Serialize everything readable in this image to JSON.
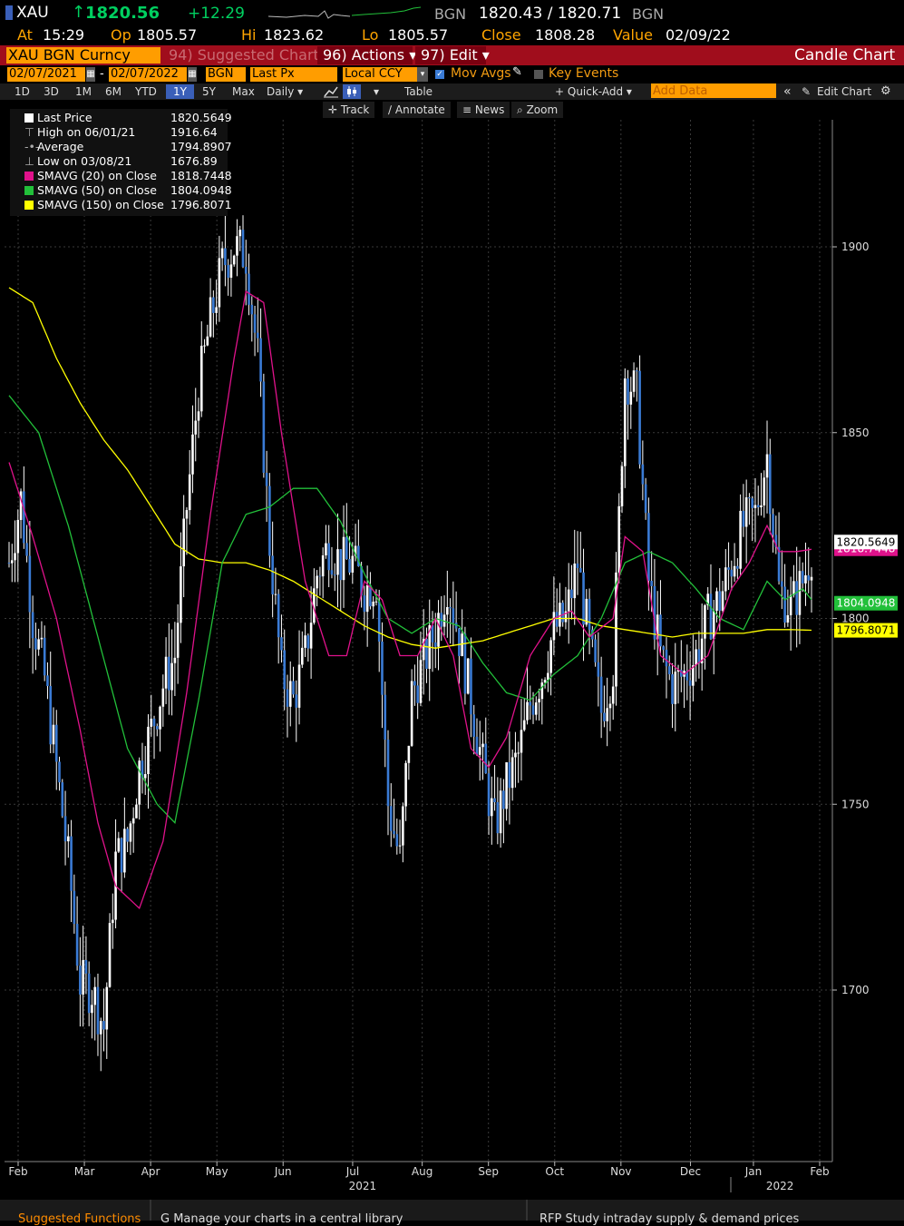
{
  "header": {
    "ticker": "XAU",
    "arrow": "↑",
    "last": "1820.56",
    "change": "+12.29",
    "source1": "BGN",
    "bidask": "1820.43 / 1820.71",
    "source2": "BGN",
    "at_label": "At",
    "at_value": "15:29",
    "op_label": "Op",
    "op_value": "1805.57",
    "hi_label": "Hi",
    "hi_value": "1823.62",
    "lo_label": "Lo",
    "lo_value": "1805.57",
    "close_label": "Close",
    "close_value": "1808.28",
    "value_label": "Value",
    "value_date": "02/09/22"
  },
  "titlebar": {
    "security": "XAU BGN Curncy",
    "suggested": "94) Suggested Charts",
    "actions": "96) Actions ▾",
    "edit": "97) Edit ▾",
    "chart_name": "Candle Chart"
  },
  "controls": {
    "start_date": "02/07/2021",
    "dash": "-",
    "end_date": "02/07/2022",
    "source": "BGN",
    "field": "Last Px",
    "currency": "Local CCY",
    "mov_avgs": "Mov Avgs",
    "key_events": "Key Events"
  },
  "periods": [
    "1D",
    "3D",
    "1M",
    "6M",
    "YTD",
    "1Y",
    "5Y",
    "Max"
  ],
  "selected_period": "1Y",
  "frequency": "Daily ▾",
  "table_label": "Table",
  "quick_add": "+ Quick-Add ▾",
  "add_data_placeholder": "Add Data",
  "edit_chart": "Edit Chart",
  "tools": [
    "Track",
    "Annotate",
    "News",
    "Zoom"
  ],
  "legend": [
    {
      "label": "Last Price",
      "value": "1820.5649",
      "color": "#ffffff"
    },
    {
      "label": "High on 06/01/21",
      "value": "1916.64",
      "color": "#aaaaaa"
    },
    {
      "label": "Average",
      "value": "1794.8907",
      "color": "#aaaaaa"
    },
    {
      "label": "Low on 03/08/21",
      "value": "1676.89",
      "color": "#aaaaaa"
    },
    {
      "label": "SMAVG (20)  on Close",
      "value": "1818.7448",
      "color": "#e0128b"
    },
    {
      "label": "SMAVG (50)  on Close",
      "value": "1804.0948",
      "color": "#22c03a"
    },
    {
      "label": "SMAVG (150)  on Close",
      "value": "1796.8071",
      "color": "#ffff00"
    }
  ],
  "bottom_bar": {
    "item1": "Suggested Functions",
    "item2": "G  Manage your charts in a central library",
    "item3": "RFP  Study intraday supply & demand prices"
  },
  "chart_data": {
    "type": "candlestick",
    "ylim": [
      1665,
      1935
    ],
    "y_ticks": [
      1700,
      1750,
      1800,
      1850,
      1900
    ],
    "x_ticks": [
      {
        "label": "Feb",
        "d": 0
      },
      {
        "label": "Mar",
        "d": 20
      },
      {
        "label": "Apr",
        "d": 40
      },
      {
        "label": "May",
        "d": 60
      },
      {
        "label": "Jun",
        "d": 80
      },
      {
        "label": "Jul",
        "d": 101
      },
      {
        "label": "Aug",
        "d": 122
      },
      {
        "label": "Sep",
        "d": 142
      },
      {
        "label": "Oct",
        "d": 162
      },
      {
        "label": "Nov",
        "d": 182
      },
      {
        "label": "Dec",
        "d": 203
      },
      {
        "label": "Jan",
        "d": 222
      },
      {
        "label": "Feb",
        "d": 242
      }
    ],
    "year_labels": [
      {
        "label": "2021",
        "d": 104
      },
      {
        "label": "2022",
        "d": 230
      }
    ],
    "last_price": 1820.5649,
    "sma20_last": 1818.7448,
    "sma50_last": 1804.0948,
    "sma150_last": 1796.8071,
    "close_keys": [
      [
        0,
        1815
      ],
      [
        4,
        1832
      ],
      [
        8,
        1800
      ],
      [
        12,
        1784
      ],
      [
        16,
        1760
      ],
      [
        20,
        1735
      ],
      [
        24,
        1702
      ],
      [
        28,
        1700
      ],
      [
        32,
        1690
      ],
      [
        36,
        1735
      ],
      [
        40,
        1740
      ],
      [
        44,
        1760
      ],
      [
        48,
        1770
      ],
      [
        52,
        1782
      ],
      [
        56,
        1790
      ],
      [
        60,
        1830
      ],
      [
        64,
        1862
      ],
      [
        68,
        1880
      ],
      [
        72,
        1895
      ],
      [
        76,
        1900
      ],
      [
        80,
        1898
      ],
      [
        84,
        1870
      ],
      [
        88,
        1820
      ],
      [
        92,
        1785
      ],
      [
        96,
        1778
      ],
      [
        100,
        1790
      ],
      [
        104,
        1812
      ],
      [
        108,
        1820
      ],
      [
        112,
        1815
      ],
      [
        116,
        1815
      ],
      [
        120,
        1808
      ],
      [
        124,
        1810
      ],
      [
        128,
        1750
      ],
      [
        132,
        1735
      ],
      [
        136,
        1780
      ],
      [
        140,
        1788
      ],
      [
        144,
        1797
      ],
      [
        148,
        1810
      ],
      [
        152,
        1795
      ],
      [
        156,
        1778
      ],
      [
        160,
        1760
      ],
      [
        164,
        1744
      ],
      [
        168,
        1755
      ],
      [
        172,
        1763
      ],
      [
        176,
        1777
      ],
      [
        180,
        1785
      ],
      [
        184,
        1797
      ],
      [
        188,
        1800
      ],
      [
        192,
        1815
      ],
      [
        196,
        1793
      ],
      [
        200,
        1775
      ],
      [
        204,
        1787
      ],
      [
        208,
        1866
      ],
      [
        212,
        1860
      ],
      [
        216,
        1810
      ],
      [
        220,
        1790
      ],
      [
        224,
        1782
      ],
      [
        228,
        1785
      ],
      [
        232,
        1790
      ],
      [
        236,
        1800
      ],
      [
        240,
        1805
      ],
      [
        244,
        1815
      ],
      [
        248,
        1825
      ],
      [
        252,
        1828
      ],
      [
        256,
        1844
      ],
      [
        260,
        1808
      ],
      [
        264,
        1803
      ],
      [
        268,
        1810
      ],
      [
        272,
        1820.56
      ]
    ],
    "sma20_keys": [
      [
        0,
        1842
      ],
      [
        8,
        1822
      ],
      [
        16,
        1800
      ],
      [
        24,
        1770
      ],
      [
        30,
        1745
      ],
      [
        36,
        1728
      ],
      [
        44,
        1722
      ],
      [
        52,
        1740
      ],
      [
        60,
        1780
      ],
      [
        68,
        1828
      ],
      [
        76,
        1870
      ],
      [
        80,
        1888
      ],
      [
        86,
        1885
      ],
      [
        92,
        1850
      ],
      [
        100,
        1810
      ],
      [
        108,
        1790
      ],
      [
        114,
        1790
      ],
      [
        120,
        1810
      ],
      [
        126,
        1805
      ],
      [
        132,
        1790
      ],
      [
        138,
        1790
      ],
      [
        144,
        1800
      ],
      [
        150,
        1790
      ],
      [
        156,
        1765
      ],
      [
        162,
        1760
      ],
      [
        168,
        1768
      ],
      [
        176,
        1790
      ],
      [
        184,
        1800
      ],
      [
        190,
        1802
      ],
      [
        196,
        1795
      ],
      [
        204,
        1800
      ],
      [
        208,
        1822
      ],
      [
        214,
        1818
      ],
      [
        220,
        1790
      ],
      [
        228,
        1785
      ],
      [
        236,
        1790
      ],
      [
        244,
        1808
      ],
      [
        250,
        1815
      ],
      [
        256,
        1825
      ],
      [
        260,
        1818
      ],
      [
        266,
        1818
      ],
      [
        272,
        1818.74
      ]
    ],
    "sma50_keys": [
      [
        0,
        1860
      ],
      [
        10,
        1850
      ],
      [
        20,
        1825
      ],
      [
        30,
        1795
      ],
      [
        40,
        1765
      ],
      [
        50,
        1750
      ],
      [
        56,
        1745
      ],
      [
        64,
        1778
      ],
      [
        72,
        1815
      ],
      [
        80,
        1828
      ],
      [
        88,
        1830
      ],
      [
        96,
        1835
      ],
      [
        104,
        1835
      ],
      [
        112,
        1826
      ],
      [
        120,
        1812
      ],
      [
        128,
        1800
      ],
      [
        136,
        1796
      ],
      [
        144,
        1800
      ],
      [
        152,
        1798
      ],
      [
        160,
        1788
      ],
      [
        168,
        1780
      ],
      [
        176,
        1778
      ],
      [
        184,
        1785
      ],
      [
        192,
        1790
      ],
      [
        200,
        1800
      ],
      [
        208,
        1815
      ],
      [
        216,
        1818
      ],
      [
        224,
        1815
      ],
      [
        232,
        1808
      ],
      [
        240,
        1800
      ],
      [
        248,
        1797
      ],
      [
        256,
        1810
      ],
      [
        262,
        1805
      ],
      [
        268,
        1808
      ],
      [
        272,
        1804.09
      ]
    ],
    "sma150_keys": [
      [
        0,
        1889
      ],
      [
        8,
        1885
      ],
      [
        16,
        1870
      ],
      [
        24,
        1858
      ],
      [
        32,
        1848
      ],
      [
        40,
        1840
      ],
      [
        48,
        1830
      ],
      [
        56,
        1820
      ],
      [
        64,
        1816
      ],
      [
        72,
        1815
      ],
      [
        80,
        1815
      ],
      [
        88,
        1813
      ],
      [
        96,
        1810
      ],
      [
        104,
        1806
      ],
      [
        112,
        1802
      ],
      [
        120,
        1798
      ],
      [
        128,
        1795
      ],
      [
        136,
        1793
      ],
      [
        144,
        1792
      ],
      [
        152,
        1793
      ],
      [
        160,
        1794
      ],
      [
        168,
        1796
      ],
      [
        176,
        1798
      ],
      [
        184,
        1800
      ],
      [
        192,
        1800
      ],
      [
        200,
        1798
      ],
      [
        208,
        1797
      ],
      [
        216,
        1796
      ],
      [
        224,
        1795
      ],
      [
        232,
        1796
      ],
      [
        240,
        1796
      ],
      [
        248,
        1796
      ],
      [
        256,
        1797
      ],
      [
        264,
        1797
      ],
      [
        272,
        1796.81
      ]
    ]
  }
}
